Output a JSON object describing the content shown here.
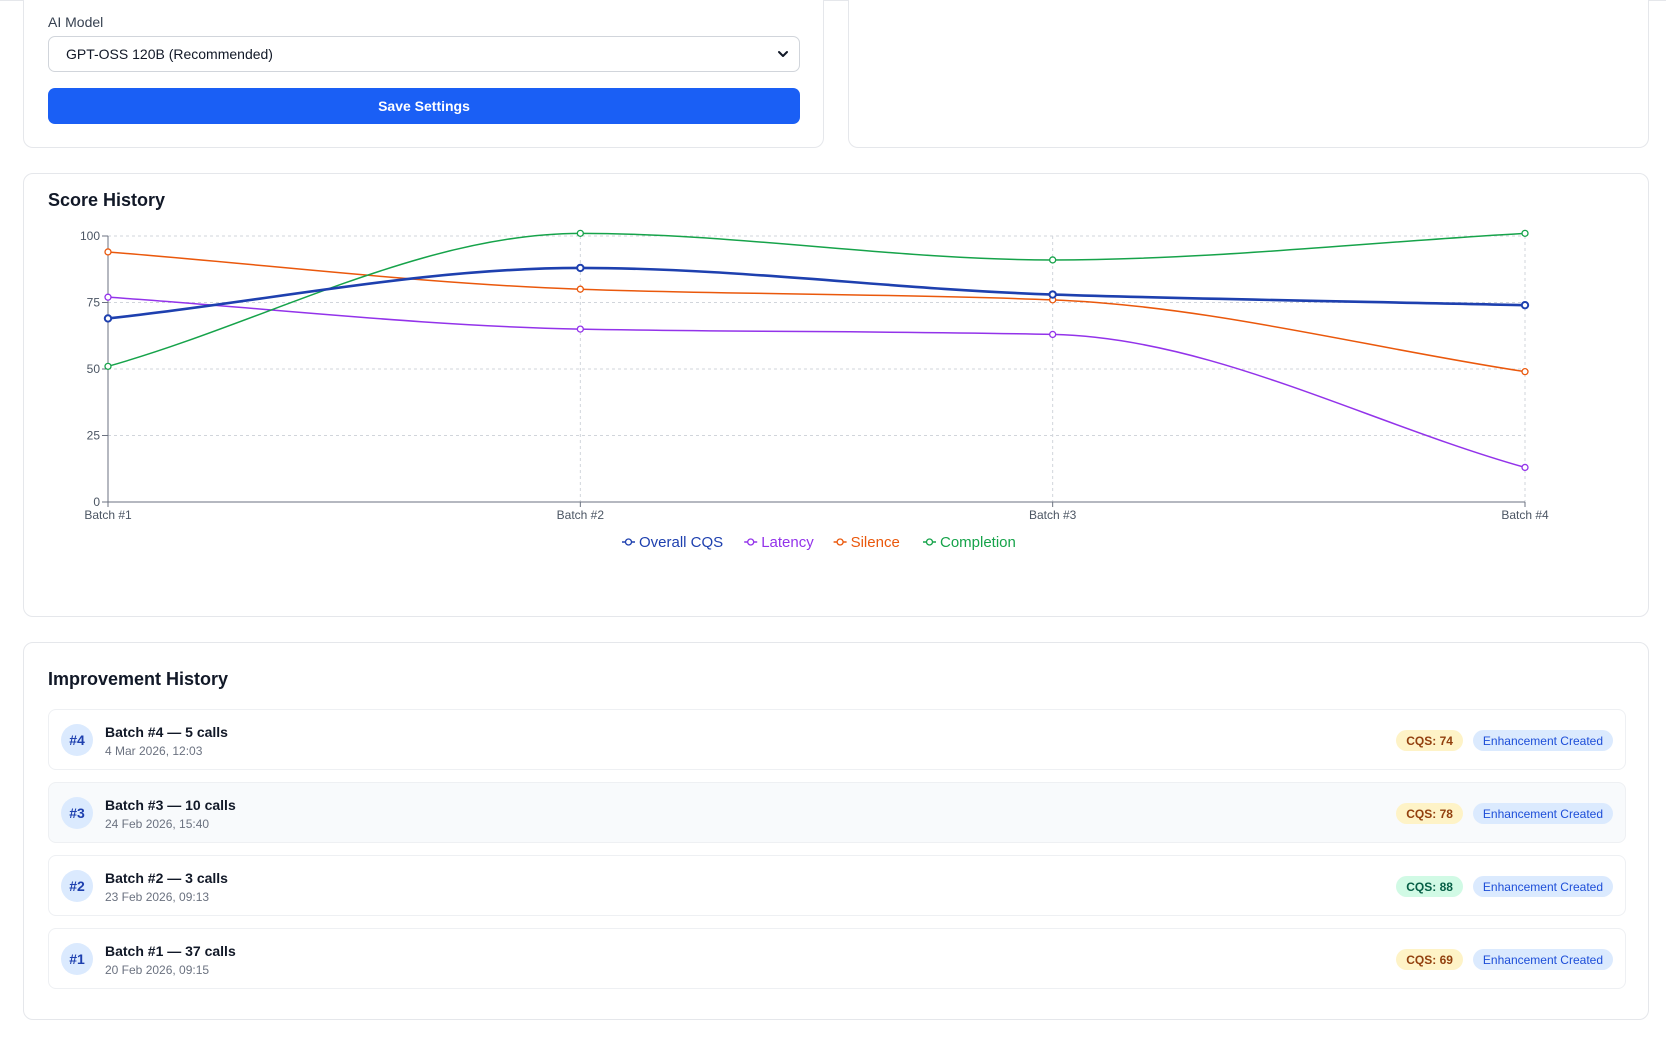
{
  "settings": {
    "model_label": "AI Model",
    "model_value": "GPT-OSS 120B (Recommended)",
    "save_label": "Save Settings"
  },
  "score_history": {
    "title": "Score History"
  },
  "chart_data": {
    "type": "line",
    "title": "Score History",
    "categories": [
      "Batch #1",
      "Batch #2",
      "Batch #3",
      "Batch #4"
    ],
    "ylim": [
      0,
      100
    ],
    "yticks": [
      0,
      25,
      50,
      75,
      100
    ],
    "grid": true,
    "legend": "bottom-center",
    "series": [
      {
        "name": "Overall CQS",
        "color": "#1e40af",
        "values": [
          69,
          88,
          78,
          74
        ]
      },
      {
        "name": "Latency",
        "color": "#9333ea",
        "values": [
          77,
          65,
          63,
          13
        ]
      },
      {
        "name": "Silence",
        "color": "#ea580c",
        "values": [
          94,
          80,
          76,
          49
        ]
      },
      {
        "name": "Completion",
        "color": "#16a34a",
        "values": [
          51,
          101,
          91,
          101
        ]
      }
    ]
  },
  "improvement_history": {
    "title": "Improvement History",
    "items": [
      {
        "num": "#4",
        "title": "Batch #4 — 5 calls",
        "date": "4 Mar 2026, 12:03",
        "cqs": "CQS: 74",
        "cqs_bg": "#fef3c7",
        "cqs_fg": "#92400e",
        "status": "Enhancement Created"
      },
      {
        "num": "#3",
        "title": "Batch #3 — 10 calls",
        "date": "24 Feb 2026, 15:40",
        "cqs": "CQS: 78",
        "cqs_bg": "#fef3c7",
        "cqs_fg": "#92400e",
        "status": "Enhancement Created"
      },
      {
        "num": "#2",
        "title": "Batch #2 — 3 calls",
        "date": "23 Feb 2026, 09:13",
        "cqs": "CQS: 88",
        "cqs_bg": "#d1fae5",
        "cqs_fg": "#065f46",
        "status": "Enhancement Created"
      },
      {
        "num": "#1",
        "title": "Batch #1 — 37 calls",
        "date": "20 Feb 2026, 09:15",
        "cqs": "CQS: 69",
        "cqs_bg": "#fef3c7",
        "cqs_fg": "#92400e",
        "status": "Enhancement Created"
      }
    ]
  }
}
